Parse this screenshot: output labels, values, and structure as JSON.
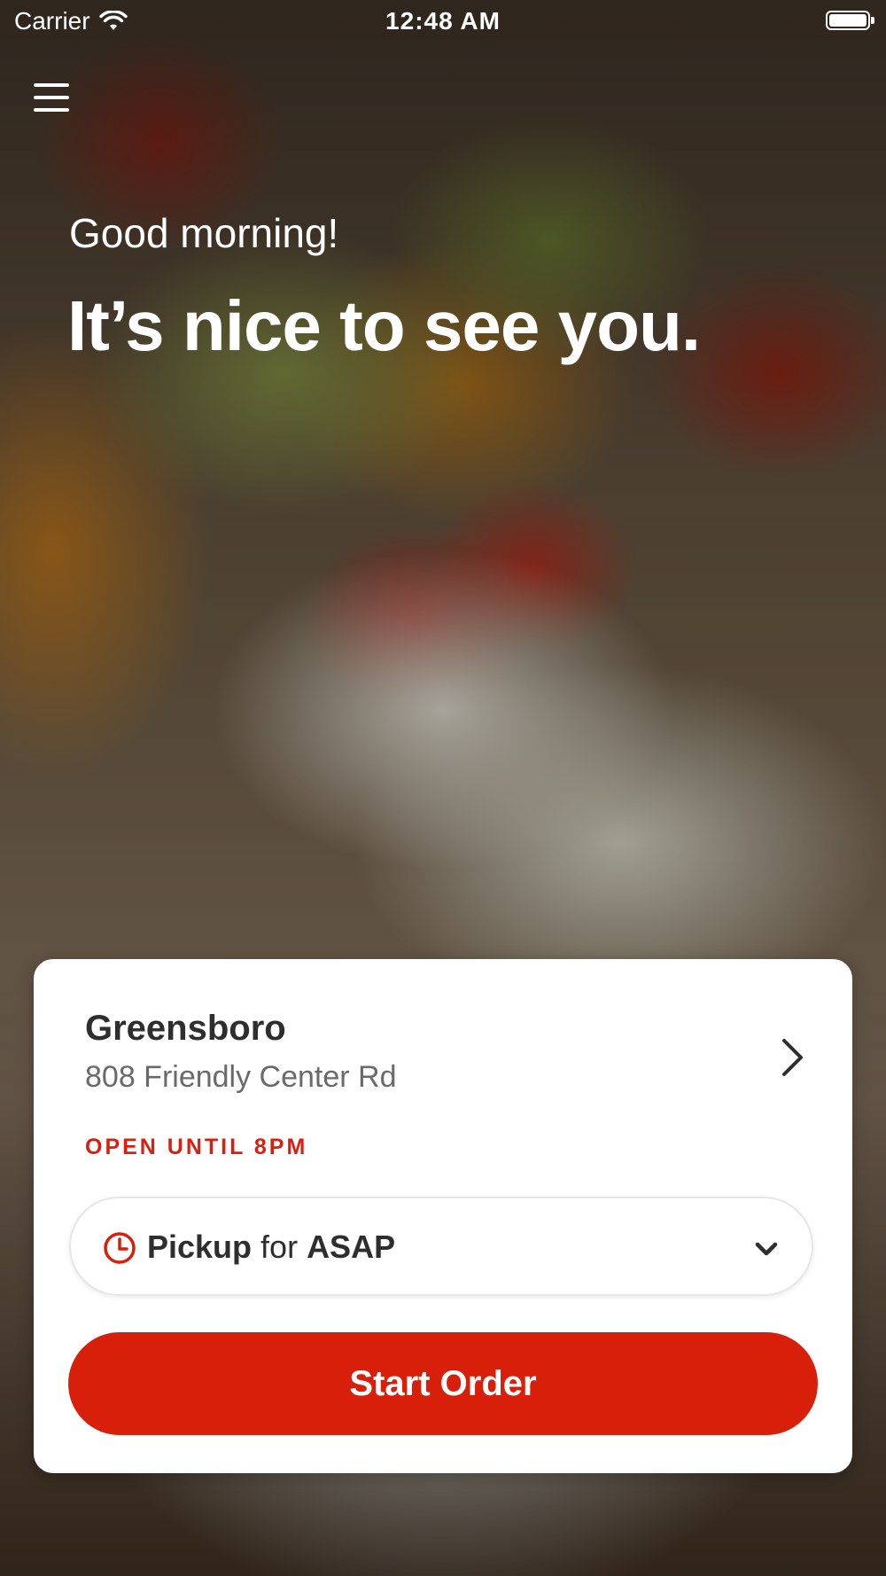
{
  "status_bar": {
    "carrier": "Carrier",
    "time": "12:48 AM",
    "icons": [
      "wifi-icon",
      "battery-icon"
    ]
  },
  "header": {
    "menu_icon": "hamburger-menu-icon"
  },
  "hero": {
    "greeting": "Good morning!",
    "headline": "It’s nice to see you."
  },
  "location_card": {
    "name": "Greensboro",
    "address": "808 Friendly Center Rd",
    "open_status": "OPEN UNTIL 8PM",
    "order_mode": {
      "method": "Pickup",
      "connector": "for",
      "time": "ASAP"
    },
    "start_order_label": "Start Order"
  },
  "colors": {
    "accent": "#d81f0a",
    "text_dark": "#2e2e2e",
    "text_muted": "#6a6a6a",
    "card_bg": "#ffffff"
  }
}
